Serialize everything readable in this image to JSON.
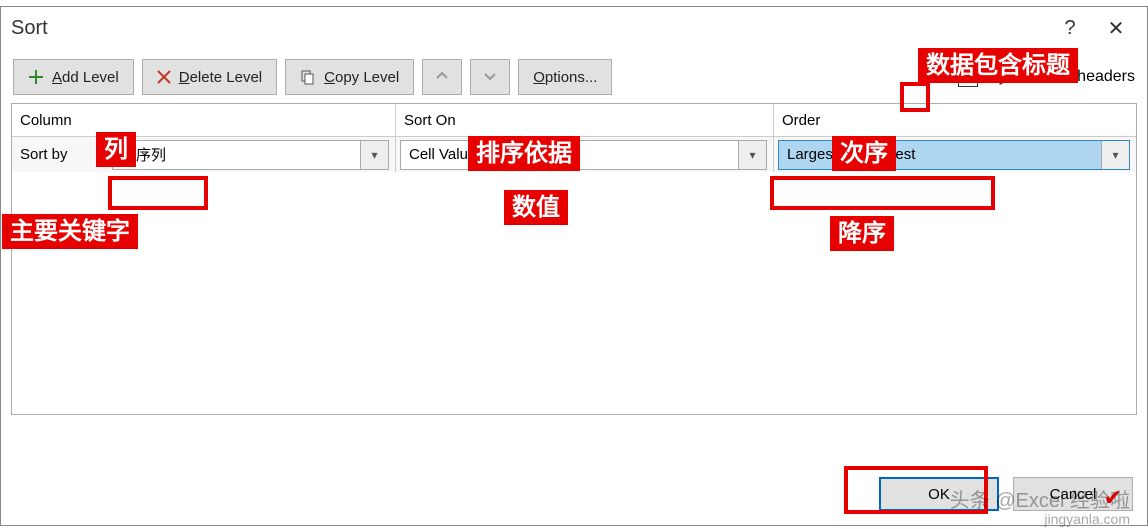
{
  "window": {
    "title": "Sort"
  },
  "titlebar_icons": {
    "help": "?",
    "close": "✕"
  },
  "toolbar": {
    "add_prefix": "A",
    "add_rest": "dd Level",
    "delete_prefix": "D",
    "delete_rest": "elete Level",
    "copy_prefix": "C",
    "copy_rest": "opy Level",
    "options_prefix": "O",
    "options_rest": "ptions...",
    "headers_prefix": "My data has ",
    "headers_ul": "h",
    "headers_rest": "eaders"
  },
  "grid": {
    "col1": "Column",
    "col2": "Sort On",
    "col3": "Order",
    "sortby_label": "Sort by",
    "sortby_value": "排序列",
    "sorton_value": "Cell Values",
    "order_value": "Largest to Smallest"
  },
  "buttons": {
    "ok": "OK",
    "cancel": "Cancel"
  },
  "annotations": {
    "headers_cn": "数据包含标题",
    "column_cn": "列",
    "sorton_cn": "排序依据",
    "order_cn": "次序",
    "sortby_cn": "主要关键字",
    "values_cn": "数值",
    "desc_cn": "降序"
  },
  "watermark": {
    "line1": "头条 @Excel  经验啦",
    "line2": "jingyanla.com"
  }
}
